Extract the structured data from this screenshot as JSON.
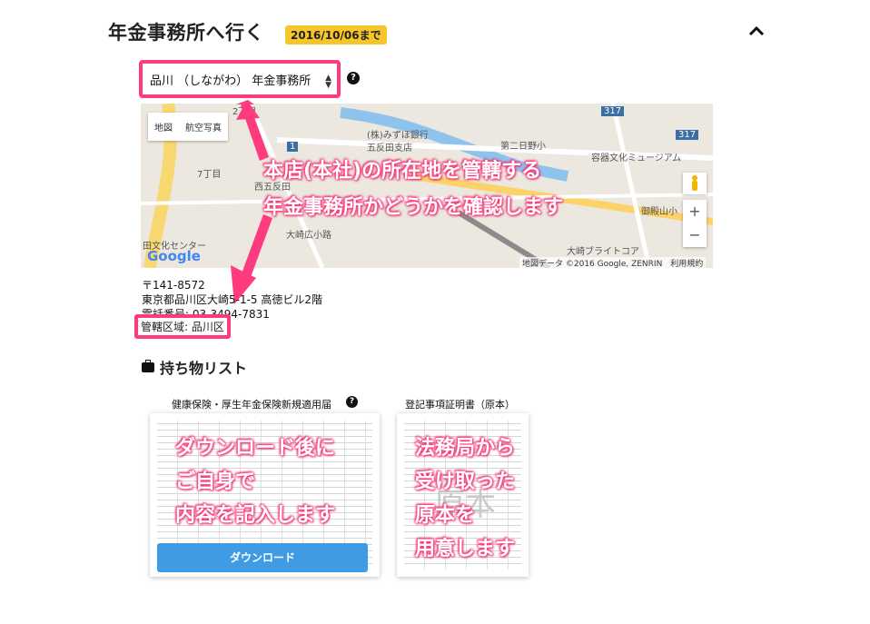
{
  "header": {
    "title": "年金事務所へ行く",
    "deadline": "2016/10/06まで"
  },
  "office_select": {
    "value": "品川 （しながわ） 年金事務所"
  },
  "map": {
    "type_buttons": [
      "地図",
      "航空写真"
    ],
    "labels": {
      "chome2": "2丁目",
      "mizuho": "(株)みずほ銀行",
      "branch": "五反田支店",
      "nichome": "第二日野小",
      "museum": "容器文化ミュージアム",
      "chome7": "7丁目",
      "nishigotanda": "西五反田",
      "osaki_hiro": "大崎広小路",
      "mitakayama": "御殿山小",
      "center": "田文化センター",
      "bright": "大崎ブライトコア",
      "route317a": "317",
      "route317b": "317",
      "route1": "1"
    },
    "google": "Google",
    "attribution": "地図データ ©2016 Google, ZENRIN　利用規約"
  },
  "callouts": {
    "map_line1": "本店(本社)の所在地を管轄する",
    "map_line2": "年金事務所かどうかを確認します",
    "card1_line1": "ダウンロード後に",
    "card1_line2": "ご自身で",
    "card1_line3": "内容を記入します",
    "card2_line1": "法務局から",
    "card2_line2": "受け取った",
    "card2_line3": "原本を",
    "card2_line4": "用意します"
  },
  "address": {
    "postal": "〒141-8572",
    "street": "東京都品川区大崎5-1-5 高徳ビル2階",
    "phone": "電話番号: 03-3494-7831",
    "jurisdiction": "管轄区域: 品川区"
  },
  "items": {
    "heading": "持ち物リスト",
    "cards": [
      {
        "title": "健康保険・厚生年金保険新規適用届",
        "button": "ダウンロード"
      },
      {
        "title": "登記事項証明書（原本）",
        "stamp": "原本"
      }
    ]
  },
  "colors": {
    "accent_pink": "#ff3b7f",
    "badge_yellow": "#f5c52a",
    "button_blue": "#3f9be3"
  }
}
